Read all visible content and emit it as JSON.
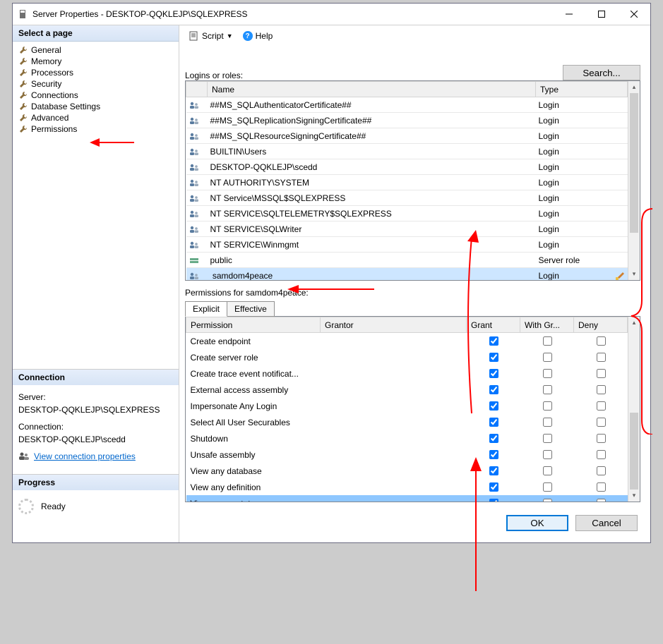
{
  "window": {
    "title": "Server Properties - DESKTOP-QQKLEJP\\SQLEXPRESS"
  },
  "sidebar": {
    "header": "Select a page",
    "pages": [
      {
        "label": "General"
      },
      {
        "label": "Memory"
      },
      {
        "label": "Processors"
      },
      {
        "label": "Security"
      },
      {
        "label": "Connections"
      },
      {
        "label": "Database Settings"
      },
      {
        "label": "Advanced"
      },
      {
        "label": "Permissions"
      }
    ],
    "selected_index": 7
  },
  "connection": {
    "header": "Connection",
    "server_label": "Server:",
    "server_value": "DESKTOP-QQKLEJP\\SQLEXPRESS",
    "connection_label": "Connection:",
    "connection_value": "DESKTOP-QQKLEJP\\scedd",
    "link": "View connection properties"
  },
  "progress": {
    "header": "Progress",
    "status": "Ready"
  },
  "toolbar": {
    "script": "Script",
    "help": "Help"
  },
  "main": {
    "logins_label": "Logins or roles:",
    "search_btn": "Search...",
    "columns": {
      "name": "Name",
      "type": "Type"
    },
    "rows": [
      {
        "name": "##MS_SQLAuthenticatorCertificate##",
        "type": "Login",
        "icon": "login"
      },
      {
        "name": "##MS_SQLReplicationSigningCertificate##",
        "type": "Login",
        "icon": "login"
      },
      {
        "name": "##MS_SQLResourceSigningCertificate##",
        "type": "Login",
        "icon": "login"
      },
      {
        "name": "BUILTIN\\Users",
        "type": "Login",
        "icon": "login"
      },
      {
        "name": "DESKTOP-QQKLEJP\\scedd",
        "type": "Login",
        "icon": "login"
      },
      {
        "name": "NT AUTHORITY\\SYSTEM",
        "type": "Login",
        "icon": "login"
      },
      {
        "name": "NT Service\\MSSQL$SQLEXPRESS",
        "type": "Login",
        "icon": "login"
      },
      {
        "name": "NT SERVICE\\SQLTELEMETRY$SQLEXPRESS",
        "type": "Login",
        "icon": "login"
      },
      {
        "name": "NT SERVICE\\SQLWriter",
        "type": "Login",
        "icon": "login"
      },
      {
        "name": "NT SERVICE\\Winmgmt",
        "type": "Login",
        "icon": "login"
      },
      {
        "name": "public",
        "type": "Server role",
        "icon": "role"
      },
      {
        "name": "samdom4peace",
        "type": "Login",
        "icon": "login"
      }
    ],
    "selected_row_index": 11,
    "permissions_for_label": "Permissions for samdom4peace:",
    "tabs": {
      "explicit": "Explicit",
      "effective": "Effective"
    },
    "perm_columns": {
      "permission": "Permission",
      "grantor": "Grantor",
      "grant": "Grant",
      "withgr": "With Gr...",
      "deny": "Deny"
    },
    "perm_rows": [
      {
        "permission": "Create endpoint",
        "grantor": "",
        "grant": true,
        "withgr": false,
        "deny": false
      },
      {
        "permission": "Create server role",
        "grantor": "",
        "grant": true,
        "withgr": false,
        "deny": false
      },
      {
        "permission": "Create trace event notificat...",
        "grantor": "",
        "grant": true,
        "withgr": false,
        "deny": false
      },
      {
        "permission": "External access assembly",
        "grantor": "",
        "grant": true,
        "withgr": false,
        "deny": false
      },
      {
        "permission": "Impersonate Any Login",
        "grantor": "",
        "grant": true,
        "withgr": false,
        "deny": false
      },
      {
        "permission": "Select All User Securables",
        "grantor": "",
        "grant": true,
        "withgr": false,
        "deny": false
      },
      {
        "permission": "Shutdown",
        "grantor": "",
        "grant": true,
        "withgr": false,
        "deny": false
      },
      {
        "permission": "Unsafe assembly",
        "grantor": "",
        "grant": true,
        "withgr": false,
        "deny": false
      },
      {
        "permission": "View any database",
        "grantor": "",
        "grant": true,
        "withgr": false,
        "deny": false
      },
      {
        "permission": "View any definition",
        "grantor": "",
        "grant": true,
        "withgr": false,
        "deny": false
      },
      {
        "permission": "View server state",
        "grantor": "",
        "grant": true,
        "withgr": false,
        "deny": false
      }
    ],
    "highlight_row_index": 10
  },
  "buttons": {
    "ok": "OK",
    "cancel": "Cancel"
  }
}
